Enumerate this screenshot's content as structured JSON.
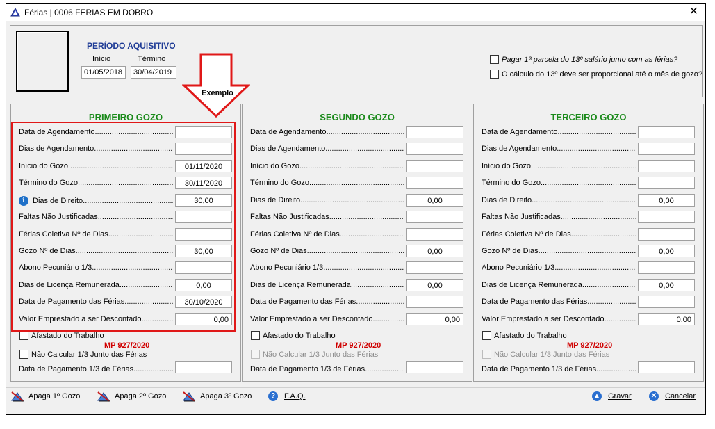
{
  "window": {
    "title": "Férias | 0006 FERIAS EM DOBRO",
    "close_glyph": "✕"
  },
  "header": {
    "periodo_title": "PERÍODO AQUISITIVO",
    "inicio_label": "Início",
    "termino_label": "Término",
    "inicio_value": "01/05/2018",
    "termino_value": "30/04/2019",
    "check_13_parcela": "Pagar 1ª parcela do 13º salário junto com as férias?",
    "check_13_proporcional": "O cálculo do 13º deve ser proporcional até o mês de gozo?"
  },
  "annotation": {
    "exemplo": "Exemplo"
  },
  "labels": {
    "data_agendamento": "Data de Agendamento",
    "dias_agendamento": "Dias de Agendamento",
    "inicio_gozo": "Início do Gozo",
    "termino_gozo": "Término do Gozo",
    "dias_direito": "Dias de Direito",
    "faltas": "Faltas Não Justificadas",
    "ferias_coletiva": "Férias Coletiva Nº de Dias",
    "gozo_dias": "Gozo Nº de Dias",
    "abono": "Abono Pecuniário 1/3",
    "licenca": "Dias de Licença Remunerada",
    "data_pagamento": "Data de Pagamento das Férias",
    "valor_emprestado": "Valor Emprestado a ser Descontado",
    "afastado": "Afastado do Trabalho",
    "mp": "MP 927/2020",
    "nao_calcular": "Não Calcular 1/3 Junto das Férias",
    "data_pag_13": "Data de Pagamento 1/3 de Férias"
  },
  "gozos": [
    {
      "title": "PRIMEIRO GOZO",
      "values": {
        "data_agendamento": "",
        "dias_agendamento": "",
        "inicio_gozo": "01/11/2020",
        "termino_gozo": "30/11/2020",
        "dias_direito": "30,00",
        "faltas": "",
        "ferias_coletiva": "",
        "gozo_dias": "30,00",
        "abono": "",
        "licenca": "0,00",
        "data_pagamento": "30/10/2020",
        "valor_emprestado": "0,00",
        "data_pag_13": ""
      }
    },
    {
      "title": "SEGUNDO GOZO",
      "values": {
        "data_agendamento": "",
        "dias_agendamento": "",
        "inicio_gozo": "",
        "termino_gozo": "",
        "dias_direito": "0,00",
        "faltas": "",
        "ferias_coletiva": "",
        "gozo_dias": "0,00",
        "abono": "",
        "licenca": "0,00",
        "data_pagamento": "",
        "valor_emprestado": "0,00",
        "data_pag_13": ""
      }
    },
    {
      "title": "TERCEIRO GOZO",
      "values": {
        "data_agendamento": "",
        "dias_agendamento": "",
        "inicio_gozo": "",
        "termino_gozo": "",
        "dias_direito": "0,00",
        "faltas": "",
        "ferias_coletiva": "",
        "gozo_dias": "0,00",
        "abono": "",
        "licenca": "0,00",
        "data_pagamento": "",
        "valor_emprestado": "0,00",
        "data_pag_13": ""
      }
    }
  ],
  "toolbar": {
    "apaga1": "Apaga 1º Gozo",
    "apaga2": "Apaga 2º Gozo",
    "apaga3": "Apaga 3º Gozo",
    "faq": "F.A.Q.",
    "gravar": "Gravar",
    "cancelar": "Cancelar"
  },
  "colors": {
    "title_blue": "#1f3c96",
    "gozo_green": "#1a8a1a",
    "mp_red": "#d00000",
    "annotation_red": "#e01818"
  }
}
